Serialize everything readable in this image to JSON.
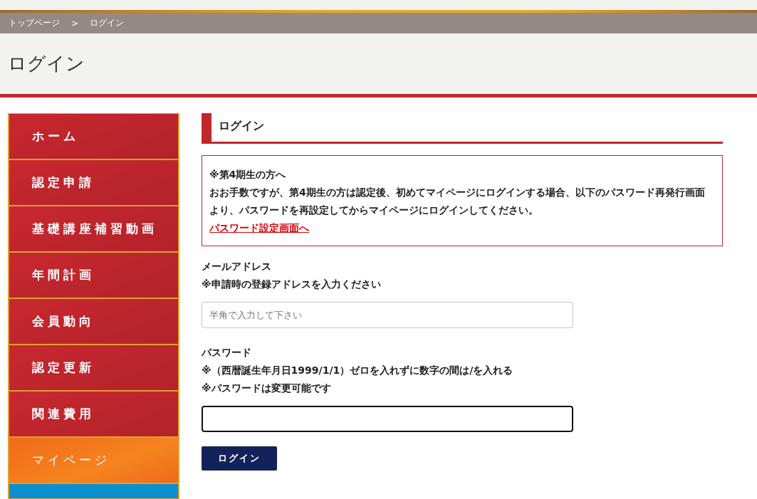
{
  "breadcrumb": [
    "トップページ",
    ">",
    "ログイン"
  ],
  "page_title": "ログイン",
  "sidebar": {
    "items": [
      {
        "label": "ホーム",
        "selected": false
      },
      {
        "label": "認定申請",
        "selected": false
      },
      {
        "label": "基礎講座補習動画",
        "selected": false
      },
      {
        "label": "年間計画",
        "selected": false
      },
      {
        "label": "会員動向",
        "selected": false
      },
      {
        "label": "認定更新",
        "selected": false
      },
      {
        "label": "関連費用",
        "selected": false
      },
      {
        "label": "マイページ",
        "selected": true
      }
    ]
  },
  "section_title": "ログイン",
  "notice": {
    "title": "※第4期生の方へ",
    "body": "おお手数ですが、第4期生の方は認定後、初めてマイページにログインする場合、以下のパスワード再発行画面より、パスワードを再設定してからマイページにログインしてください。",
    "link": "パスワード設定画面へ"
  },
  "fields": [
    {
      "label": "メールアドレス",
      "notes": [
        "※申請時の登録アドレスを入力ください"
      ],
      "placeholder": "半角で入力して下さい",
      "focused": false
    },
    {
      "label": "パスワード",
      "notes": [
        "※（西暦誕生年月日1999/1/1）ゼロを入れずに数字の間は/を入れる",
        "※パスワードは変更可能です"
      ],
      "focused": true
    }
  ],
  "submit_button": "ログイン"
}
